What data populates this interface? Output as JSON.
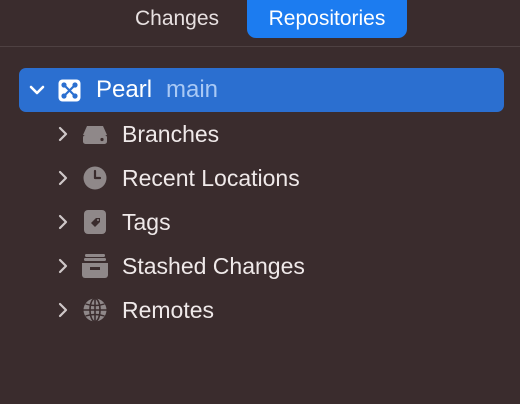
{
  "segmented": {
    "changes_label": "Changes",
    "repositories_label": "Repositories",
    "selected": "Repositories"
  },
  "repository": {
    "name": "Pearl",
    "branch": "main",
    "icon": "repository-icon",
    "expanded": true
  },
  "tree": {
    "items": [
      {
        "label": "Branches",
        "icon": "branches-drive-icon"
      },
      {
        "label": "Recent Locations",
        "icon": "clock-icon"
      },
      {
        "label": "Tags",
        "icon": "tag-icon"
      },
      {
        "label": "Stashed Changes",
        "icon": "stash-tray-icon"
      },
      {
        "label": "Remotes",
        "icon": "globe-icon"
      }
    ]
  },
  "colors": {
    "background": "#3a2c2d",
    "accent": "#1c7cf0",
    "selection": "#2b6fd0",
    "branch_text": "#a9c9f5",
    "icon_gray": "#8f8889"
  }
}
